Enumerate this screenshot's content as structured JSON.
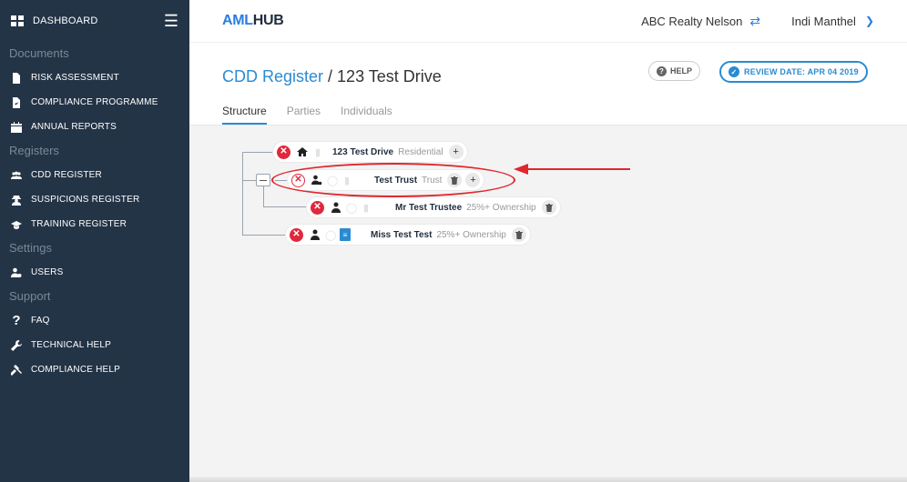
{
  "sidebar": {
    "dashboard_label": "DASHBOARD",
    "sections": [
      {
        "title": "Documents",
        "items": [
          {
            "label": "RISK ASSESSMENT",
            "icon": "document-icon"
          },
          {
            "label": "COMPLIANCE PROGRAMME",
            "icon": "document-check-icon"
          },
          {
            "label": "ANNUAL REPORTS",
            "icon": "calendar-icon"
          }
        ]
      },
      {
        "title": "Registers",
        "items": [
          {
            "label": "CDD REGISTER",
            "icon": "users-icon"
          },
          {
            "label": "SUSPICIONS REGISTER",
            "icon": "user-secret-icon"
          },
          {
            "label": "TRAINING REGISTER",
            "icon": "graduation-cap-icon"
          }
        ]
      },
      {
        "title": "Settings",
        "items": [
          {
            "label": "USERS",
            "icon": "user-cog-icon"
          }
        ]
      },
      {
        "title": "Support",
        "items": [
          {
            "label": "FAQ",
            "icon": "question-icon"
          },
          {
            "label": "TECHNICAL HELP",
            "icon": "wrench-icon"
          },
          {
            "label": "COMPLIANCE HELP",
            "icon": "gavel-icon"
          }
        ]
      }
    ]
  },
  "header": {
    "logo_aml": "AML",
    "logo_hub": "HUB",
    "organization": "ABC Realty Nelson",
    "user_name": "Indi Manthel"
  },
  "page": {
    "breadcrumb_link": "CDD Register",
    "breadcrumb_separator": " / ",
    "breadcrumb_current": "123 Test Drive",
    "help_label": "HELP",
    "review_label": "REVIEW DATE:  APR 04 2019",
    "tabs": [
      {
        "label": "Structure",
        "active": true
      },
      {
        "label": "Parties",
        "active": false
      },
      {
        "label": "Individuals",
        "active": false
      }
    ]
  },
  "tree": {
    "nodes": [
      {
        "name": "123 Test Drive",
        "type": "Residential"
      },
      {
        "name": "Test Trust",
        "type": "Trust"
      },
      {
        "name": "Mr Test Trustee",
        "type": "25%+ Ownership"
      },
      {
        "name": "Miss Test Test",
        "type": "25%+ Ownership"
      }
    ]
  },
  "colors": {
    "sidebar_bg": "#243447",
    "accent_blue": "#2a8bd1",
    "danger_red": "#e0283c",
    "annotation_red": "#e1262d"
  }
}
